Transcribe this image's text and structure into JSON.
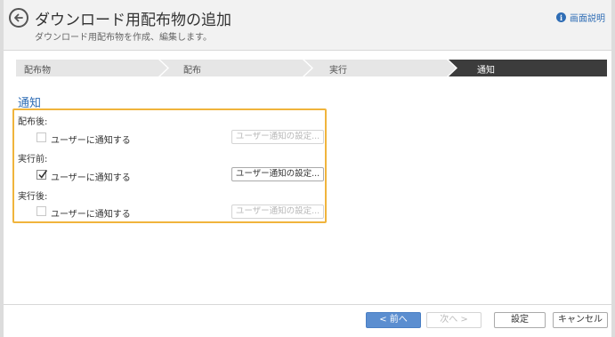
{
  "header": {
    "title": "ダウンロード用配布物の追加",
    "subtitle": "ダウンロード用配布物を作成、編集します。",
    "help_label": "画面説明",
    "help_icon": "info-icon",
    "back_icon": "back-arrow-icon"
  },
  "steps": [
    {
      "label": "配布物",
      "active": false
    },
    {
      "label": "配布",
      "active": false
    },
    {
      "label": "実行",
      "active": false
    },
    {
      "label": "通知",
      "active": true
    }
  ],
  "section": {
    "title": "通知",
    "groups": [
      {
        "label": "配布後:",
        "checkbox_label": "ユーザーに通知する",
        "checked": false,
        "button_label": "ユーザー通知の設定...",
        "button_enabled": false
      },
      {
        "label": "実行前:",
        "checkbox_label": "ユーザーに通知する",
        "checked": true,
        "button_label": "ユーザー通知の設定...",
        "button_enabled": true
      },
      {
        "label": "実行後:",
        "checkbox_label": "ユーザーに通知する",
        "checked": false,
        "button_label": "ユーザー通知の設定...",
        "button_enabled": false
      }
    ]
  },
  "footer": {
    "prev_label": "< 前へ",
    "next_label": "次へ >",
    "save_label": "設定",
    "cancel_label": "キャンセル"
  },
  "colors": {
    "accent": "#2f6db5",
    "step_active": "#3c3c3c",
    "step_inactive": "#e6e6e6",
    "highlight": "#f0b43c",
    "primary_button": "#5b8ed0"
  }
}
